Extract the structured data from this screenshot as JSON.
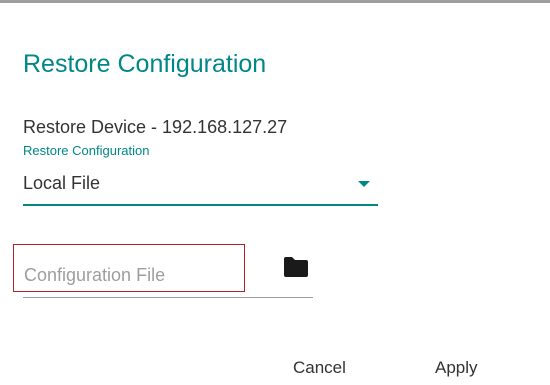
{
  "dialog": {
    "title": "Restore Configuration",
    "device_label": "Restore Device - 192.168.127.27",
    "restore_select": {
      "caption": "Restore Configuration",
      "selected_value": "Local File"
    },
    "file_field": {
      "placeholder": "Configuration File",
      "value": "",
      "browse_icon": "folder-icon"
    },
    "actions": {
      "cancel_label": "Cancel",
      "apply_label": "Apply"
    }
  },
  "colors": {
    "accent": "#008787",
    "text": "#333333",
    "placeholder": "#9e9e9e",
    "highlight_border": "#b22222"
  }
}
